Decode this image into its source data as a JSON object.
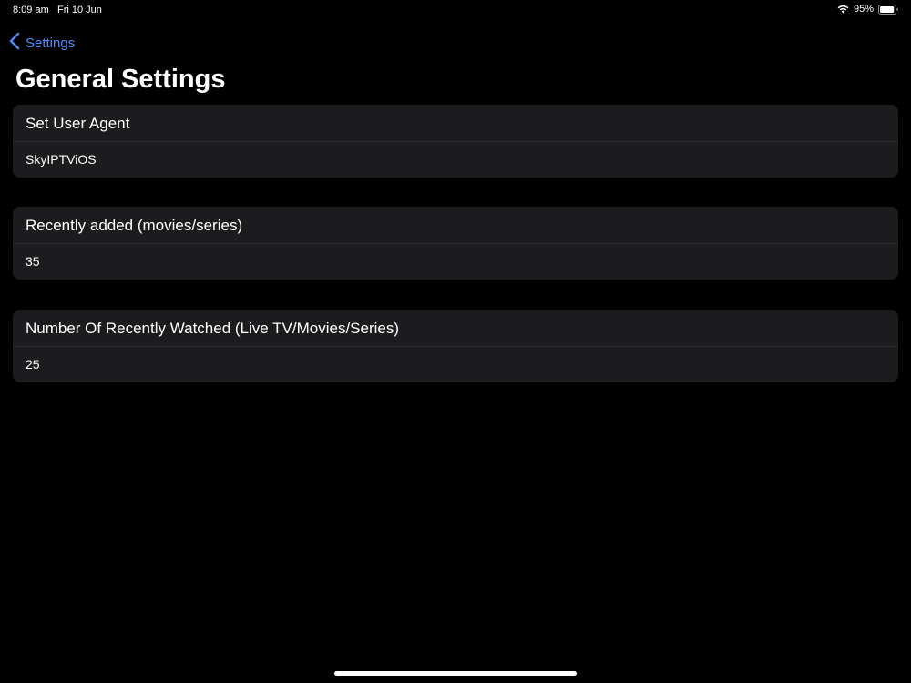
{
  "status_bar": {
    "time": "8:09 am",
    "date": "Fri 10 Jun",
    "battery_percent": "95%",
    "battery_level": 0.95
  },
  "nav": {
    "back_label": "Settings"
  },
  "page": {
    "title": "General Settings"
  },
  "settings": [
    {
      "label": "Set User Agent",
      "value": "SkyIPTViOS"
    },
    {
      "label": "Recently added (movies/series)",
      "value": "35"
    },
    {
      "label": "Number Of Recently Watched (Live TV/Movies/Series)",
      "value": "25"
    }
  ],
  "colors": {
    "background": "#000000",
    "card": "#1c1c1e",
    "accent": "#4a8cff",
    "text": "#ffffff"
  }
}
